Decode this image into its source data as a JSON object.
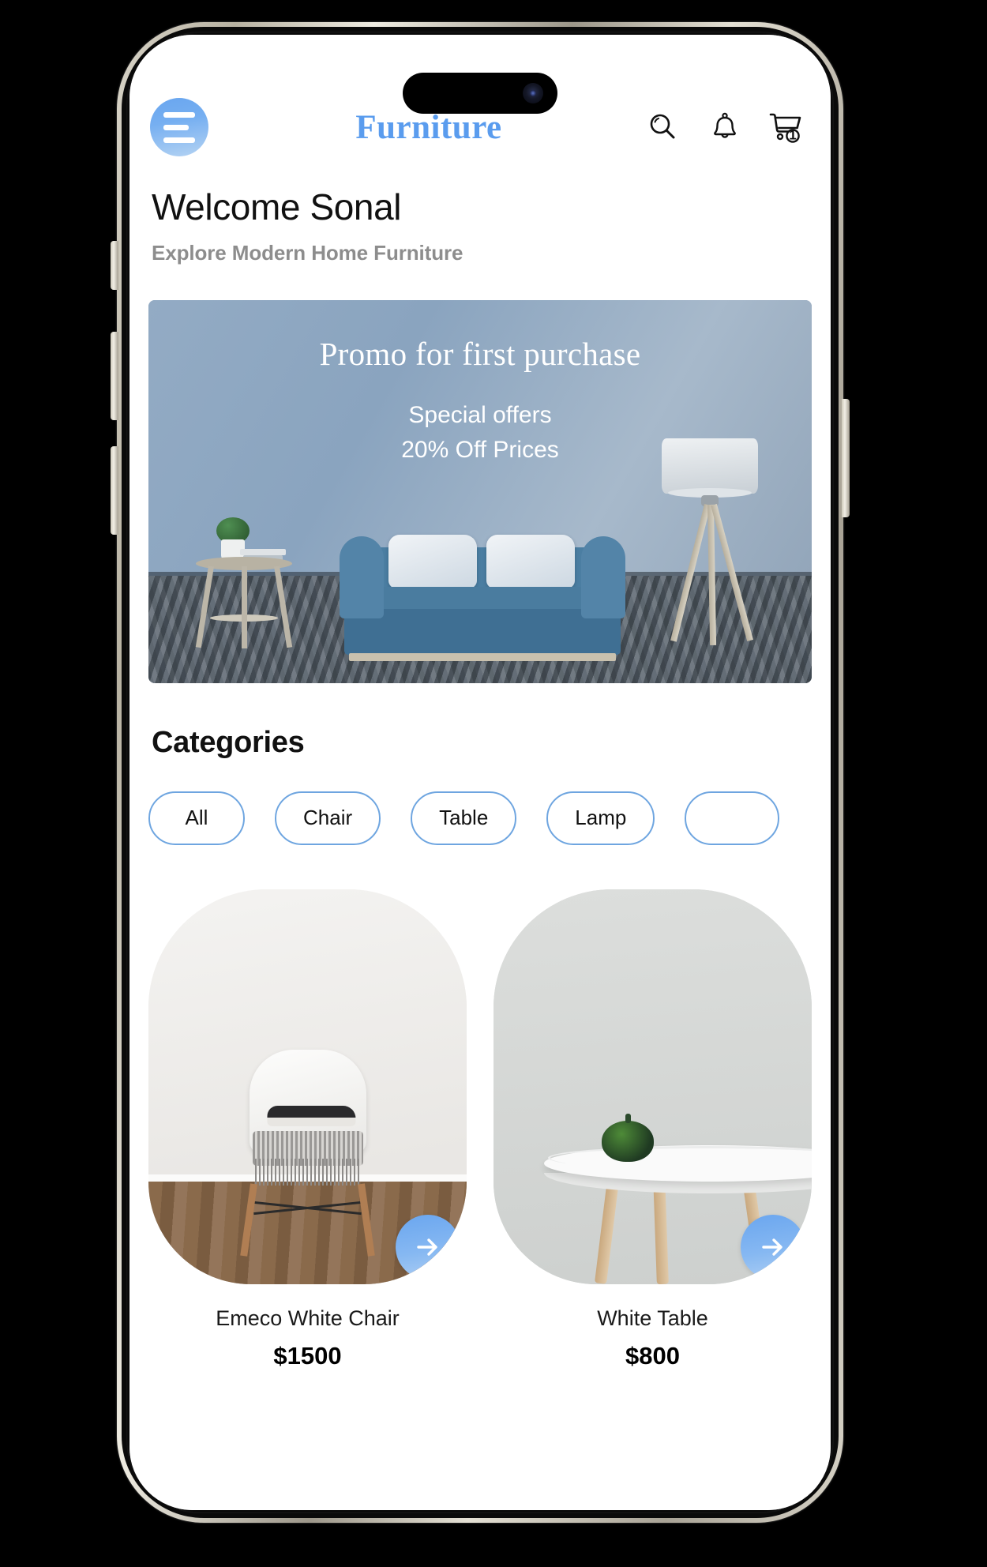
{
  "app": {
    "brand_title": "Furniture"
  },
  "header": {
    "menu_icon": "hamburger-menu-icon",
    "actions": [
      {
        "name": "search-icon",
        "label": "Search"
      },
      {
        "name": "notification-icon",
        "label": "Notifications"
      },
      {
        "name": "cart-icon",
        "label": "Cart",
        "badge": "1"
      }
    ]
  },
  "welcome": {
    "greeting": "Welcome Sonal",
    "subtitle": "Explore Modern Home Furniture"
  },
  "banner": {
    "title": "Promo for first purchase",
    "line1": "Special offers",
    "line2": "20% Off Prices"
  },
  "categories": {
    "heading": "Categories",
    "items": [
      {
        "label": "All",
        "selected": false
      },
      {
        "label": "Chair",
        "selected": false
      },
      {
        "label": "Table",
        "selected": false
      },
      {
        "label": "Lamp",
        "selected": false
      },
      {
        "label": "",
        "selected": false
      }
    ]
  },
  "products": [
    {
      "name": "Emeco White Chair",
      "price": "$1500",
      "action": "View product"
    },
    {
      "name": "White Table",
      "price": "$800",
      "action": "View product"
    }
  ],
  "colors": {
    "accent_blue": "#5a9cee",
    "pill_border": "#6ea5e0",
    "muted_text": "#8d8d8d",
    "banner_blue": "#8ea7c0"
  }
}
